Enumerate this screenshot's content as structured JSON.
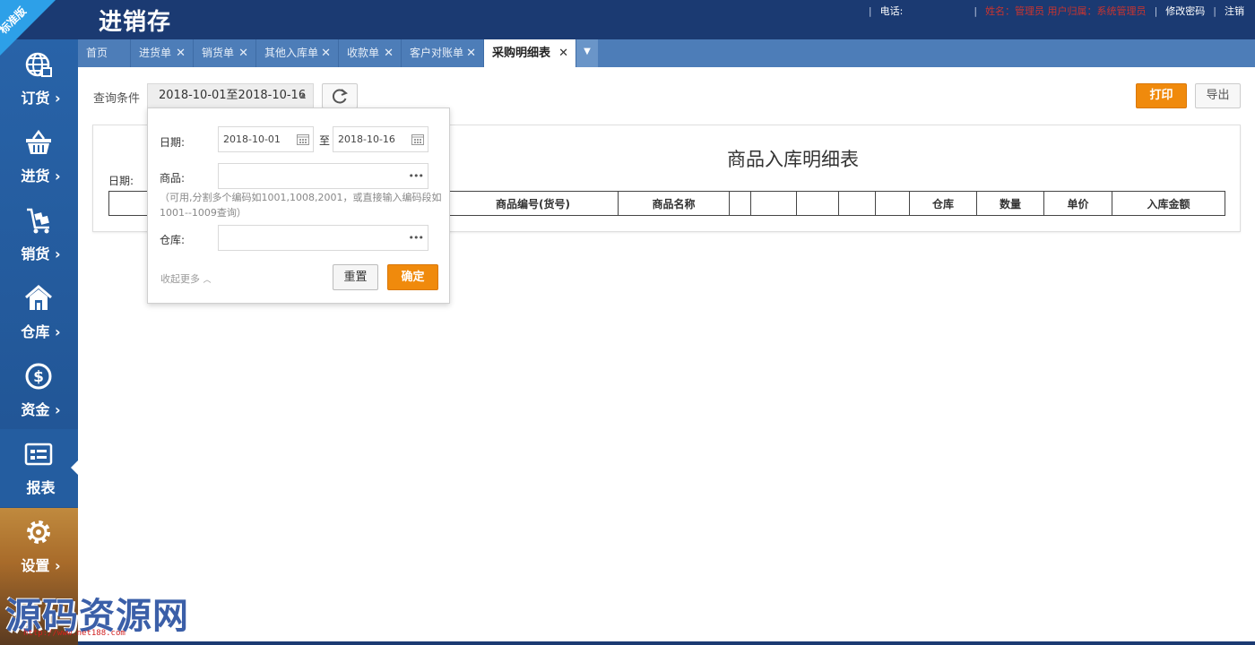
{
  "app": {
    "title": "进销存",
    "edition_badge": "标准版"
  },
  "header": {
    "phone_label": "电话:",
    "phone_value": "",
    "user_info": "姓名：管理员  用户归属：系统管理员",
    "change_password": "修改密码",
    "logout": "注销"
  },
  "sidebar": {
    "items": [
      {
        "label": "订货",
        "icon": "globe-icon"
      },
      {
        "label": "进货",
        "icon": "basket-icon"
      },
      {
        "label": "销货",
        "icon": "cart-icon"
      },
      {
        "label": "仓库",
        "icon": "warehouse-icon"
      },
      {
        "label": "资金",
        "icon": "dollar-icon"
      },
      {
        "label": "报表",
        "icon": "report-icon"
      },
      {
        "label": "设置",
        "icon": "gear-icon"
      }
    ],
    "active": "报表",
    "chevron": "›"
  },
  "tabs": [
    {
      "label": "首页",
      "closable": false
    },
    {
      "label": "进货单",
      "closable": true
    },
    {
      "label": "销货单",
      "closable": true
    },
    {
      "label": "其他入库单",
      "closable": true
    },
    {
      "label": "收款单",
      "closable": true
    },
    {
      "label": "客户对账单",
      "closable": true
    },
    {
      "label": "采购明细表",
      "closable": true,
      "active": true
    }
  ],
  "tab_close_glyph": "✕",
  "tab_more_glyph": "▼",
  "toolbar": {
    "query_label": "查询条件",
    "date_range": "2018-10-01至2018-10-16",
    "print": "打印",
    "export": "导出"
  },
  "report": {
    "title": "商品入库明细表",
    "date_label": "日期:",
    "columns": [
      "",
      "",
      "",
      "商品编号(货号)",
      "商品名称",
      "",
      "",
      "",
      "",
      "",
      "仓库",
      "数量",
      "单价",
      "入库金额"
    ]
  },
  "filter_popup": {
    "date_label": "日期:",
    "date_from": "2018-10-01",
    "to_label": "至",
    "date_to": "2018-10-16",
    "product_label": "商品:",
    "product_value": "",
    "hint": "（可用,分割多个编码如1001,1008,2001，或直接输入编码段如1001--1009查询）",
    "warehouse_label": "仓库:",
    "warehouse_value": "",
    "collapse": "收起更多",
    "reset": "重置",
    "confirm": "确定",
    "more_dots": "•••"
  },
  "watermark": {
    "text": "源码资源网",
    "url": "http://www.net188.com"
  },
  "colors": {
    "header_bg": "#1b3a72",
    "sidebar_bg": "#2863a8",
    "tab_bar_bg": "#4d7db8",
    "accent_orange": "#f08a0c",
    "badge_blue": "#2da0e8"
  }
}
